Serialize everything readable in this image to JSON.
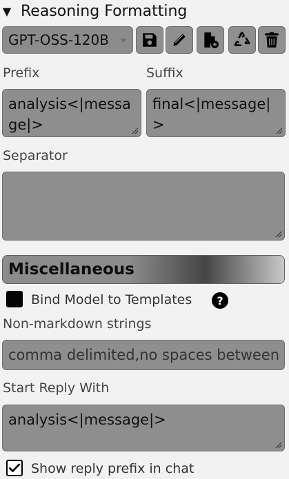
{
  "section": {
    "title": "Reasoning Formatting",
    "collapse_indicator": "▼"
  },
  "preset": {
    "selected": "GPT-OSS-120B"
  },
  "toolbar": {
    "icons": [
      "save-icon",
      "edit-icon",
      "new-file-icon",
      "recycle-icon",
      "delete-icon"
    ]
  },
  "fields": {
    "prefix_label": "Prefix",
    "prefix_value": "analysis<|message|>",
    "suffix_label": "Suffix",
    "suffix_value": "final<|message|>",
    "separator_label": "Separator",
    "separator_value": ""
  },
  "misc": {
    "title": "Miscellaneous",
    "bind_label": "Bind Model to Templates",
    "bind_checked": false,
    "help_glyph": "?",
    "non_markdown_label": "Non-markdown strings",
    "non_markdown_placeholder": "comma delimited,no spaces between",
    "start_reply_label": "Start Reply With",
    "start_reply_value": "analysis<|message|>",
    "show_prefix_label": "Show reply prefix in chat",
    "show_prefix_checked": true
  }
}
